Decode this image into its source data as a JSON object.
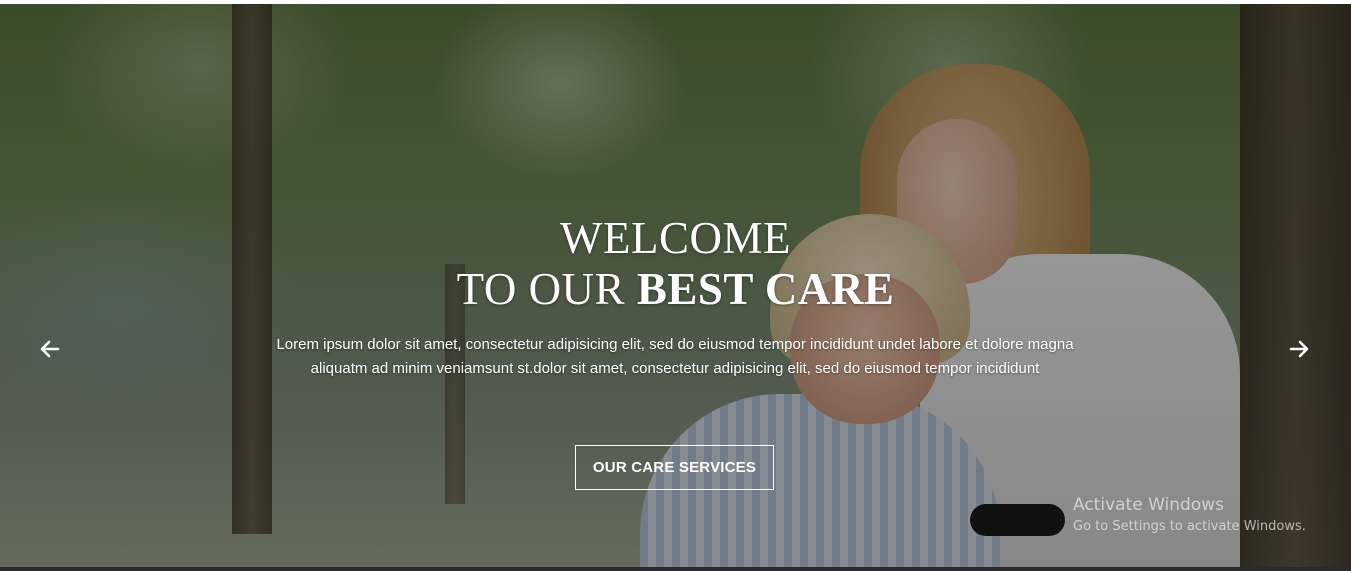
{
  "slider": {
    "headline_line1": "WELCOME",
    "headline_line2_regular": "TO OUR ",
    "headline_line2_bold": "BEST CARE",
    "description": "Lorem ipsum dolor sit amet, consectetur adipisicing elit, sed do eiusmod tempor incididunt undet labore et dolore magna aliquatm ad minim veniamsunt st.dolor sit amet, consectetur adipisicing elit, sed do eiusmod tempor incididunt",
    "cta_label": "OUR CARE SERVICES",
    "prev_icon": "arrow-left-icon",
    "next_icon": "arrow-right-icon"
  },
  "watermark": {
    "title": "Activate Windows",
    "subtitle": "Go to Settings to activate Windows."
  },
  "colors": {
    "text": "#ffffff",
    "overlay": "rgba(0,0,0,0.38)",
    "button_border": "#ffffff"
  }
}
